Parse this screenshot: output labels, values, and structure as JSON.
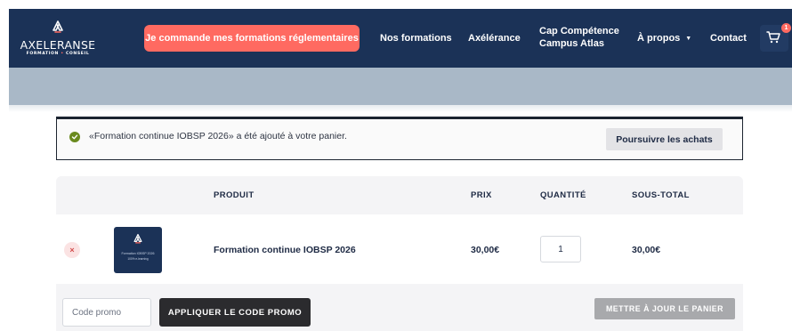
{
  "header": {
    "logo": {
      "name": "AXELERANSE",
      "tagline_left": "FORMATION",
      "tagline_sep": "•",
      "tagline_right": "CONSEIL"
    },
    "cta_label": "Je commande mes formations réglementaires",
    "nav": [
      {
        "label": "Nos formations"
      },
      {
        "label": "Axélérance"
      },
      {
        "line1": "Cap Compétence",
        "line2": "Campus Atlas"
      },
      {
        "label": "À propos",
        "chevron": "▼"
      },
      {
        "label": "Contact"
      }
    ],
    "cart_count": "1",
    "colors": {
      "header_bg": "#1b3257",
      "accent": "#ff6a61"
    }
  },
  "notice": {
    "message": "«Formation continue IOBSP 2026» a été ajouté à votre panier.",
    "button_label": "Poursuivre les achats"
  },
  "cart": {
    "columns": {
      "product": "PRODUIT",
      "price": "PRIX",
      "quantity": "QUANTITÉ",
      "subtotal": "SOUS-TOTAL"
    },
    "items": [
      {
        "remove_symbol": "×",
        "thumb_line1": "Formation IOBSP 2026",
        "thumb_line2": "100% e-learning",
        "name": "Formation continue IOBSP 2026",
        "price": "30,00€",
        "quantity": "1",
        "subtotal": "30,00€"
      }
    ],
    "promo_placeholder": "Code promo",
    "apply_label": "APPLIQUER LE CODE PROMO",
    "update_label": "METTRE À JOUR LE PANIER"
  }
}
